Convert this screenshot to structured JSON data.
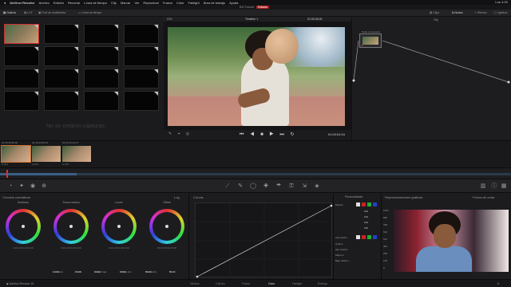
{
  "menubar": {
    "app": "DaVinci Resolve",
    "items": [
      "Archivo",
      "Edición",
      "Recortar",
      "Línea de tiempo",
      "Clip",
      "Marcar",
      "Ver",
      "Reproducir",
      "Fusion",
      "Color",
      "Fairlight",
      "Área de trabajo",
      "Ayuda"
    ],
    "status": "Lun 4:20"
  },
  "title": {
    "project": "BW Tutorial",
    "badge": "Editado"
  },
  "toolbar": {
    "gallery": "Galería",
    "lut": "LUT",
    "media_pool": "Pool de multimedia",
    "timeline": "Línea de tiempo",
    "clips": "Clips",
    "nodes": "Nodos",
    "effects": "Efectos",
    "lightbox": "Lightbox"
  },
  "viewer_header": {
    "zoom": "53%",
    "timeline_name": "Timeline 1",
    "timecode": "01:00:26:00",
    "mode": "Clip"
  },
  "gallery": {
    "empty_message": "No se crearon capturas."
  },
  "viewer": {
    "timecode": "01:00:01:04",
    "transport": "⏮ ◀ ■ ▶ ⏭ ↻",
    "tools": "✎ ⌖ ◎"
  },
  "nodes": {
    "title": "Nodo compuesto",
    "node_number": "01"
  },
  "clips": [
    {
      "num": "01",
      "timecode": "00:45:06:09",
      "codec": "H.264"
    },
    {
      "num": "02",
      "timecode": "00:43:06:19",
      "codec": "H.264"
    },
    {
      "num": "03",
      "timecode": "00:44:12:07",
      "codec": "H.264"
    }
  ],
  "wheels": {
    "title": "Círculos cromáticos",
    "mode": "Log",
    "items": [
      {
        "label": "Sombras",
        "values": "0.00  0.00  0.00  0.00"
      },
      {
        "label": "Tonos medios",
        "values": "0.00  0.00  0.00  0.00"
      },
      {
        "label": "Luces",
        "values": "0.00  0.00  0.00  0.00"
      },
      {
        "label": "Offset",
        "values": "25.00  25.00  25.00"
      }
    ],
    "params": [
      {
        "label": "Contraste",
        "value": "1.000"
      },
      {
        "label": "Pivote",
        "value": "0.435"
      },
      {
        "label": "Rango bajo",
        "value": "0.000"
      },
      {
        "label": "Rango alto",
        "value": "0.550"
      },
      {
        "label": "Saturación",
        "value": "50.00"
      },
      {
        "label": "Tono",
        "value": "50.00"
      }
    ]
  },
  "curves": {
    "title": "Curvas"
  },
  "custom": {
    "title": "Personalizada",
    "edit_label": "Edición",
    "values": [
      "100",
      "100",
      "100",
      "100"
    ],
    "soft_label": "Atenuación",
    "soft_rows": [
      "Ambos",
      "Alto relativo",
      "Máximo",
      "Bajo relativo"
    ],
    "colors": {
      "white": "#e0e0e0",
      "red": "#d02020",
      "green": "#20b030",
      "blue": "#2040d0"
    }
  },
  "scopes": {
    "title": "Representaciones gráficas",
    "type": "Forma de onda",
    "scale": [
      "1023",
      "896",
      "768",
      "640",
      "512",
      "384",
      "256",
      "128",
      "0"
    ]
  },
  "pagebar": {
    "brand": "DaVinci Resolve 15",
    "pages": [
      "Medios",
      "Edición",
      "Fusion",
      "Color",
      "Fairlight",
      "Entrega"
    ],
    "active": "Color"
  }
}
